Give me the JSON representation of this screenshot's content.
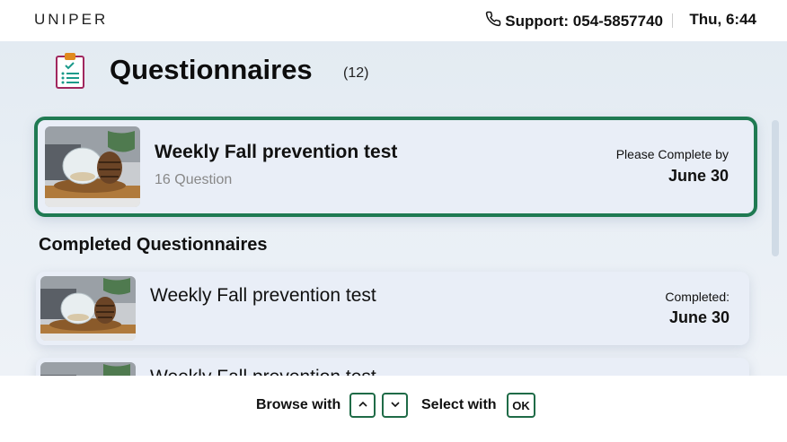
{
  "header": {
    "brand": "UNIPER",
    "support_label": "Support: 054-5857740",
    "datetime": "Thu, 6:44"
  },
  "page": {
    "title": "Questionnaires",
    "count": "(12)"
  },
  "active_questionnaire": {
    "title": "Weekly Fall prevention test",
    "subtitle": "16 Question",
    "due_label": "Please Complete by",
    "due_date": "June 30"
  },
  "completed_section": {
    "title": "Completed Questionnaires",
    "items": [
      {
        "title": "Weekly Fall prevention test",
        "status_label": "Completed:",
        "date": "June 30"
      },
      {
        "title": "Weekly Fall prevention test"
      }
    ]
  },
  "footer": {
    "browse_label": "Browse with",
    "select_label": "Select with",
    "ok_key": "OK"
  },
  "icons": {
    "phone": "phone-icon",
    "questionnaire": "clipboard-icon",
    "up": "chevron-up-icon",
    "down": "chevron-down-icon"
  },
  "colors": {
    "accent_green": "#1f7a52",
    "card_bg": "#e9eef7"
  }
}
